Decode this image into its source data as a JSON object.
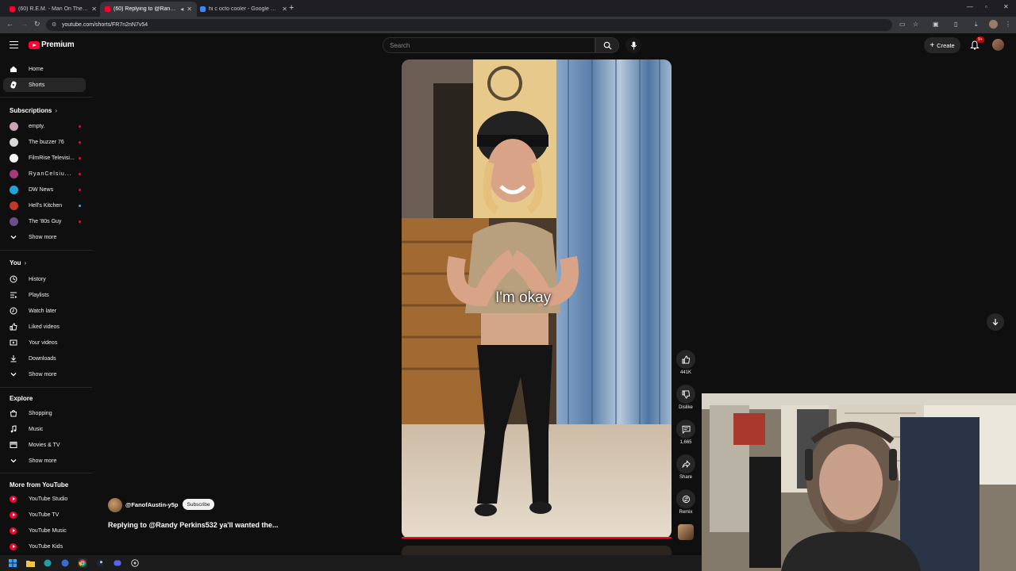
{
  "browser": {
    "tabs": [
      {
        "title": "(60) R.E.M. - Man On The Moo",
        "active": false
      },
      {
        "title": "(60) Replying to @Randy P",
        "active": true
      },
      {
        "title": "hi c octo cooler - Google Shopp",
        "active": false
      }
    ],
    "url": "youtube.com/shorts/FR7n2nN7v54"
  },
  "header": {
    "brand": "Premium",
    "search_placeholder": "Search",
    "create_label": "Create",
    "notification_count": "9+"
  },
  "sidebar": {
    "main": [
      {
        "label": "Home",
        "icon": "home-icon"
      },
      {
        "label": "Shorts",
        "icon": "shorts-icon",
        "selected": true
      }
    ],
    "subscriptions_title": "Subscriptions",
    "subscriptions": [
      {
        "label": "empty.",
        "color": "#c9a3b6"
      },
      {
        "label": "The buzzer 76",
        "color": "#d8d8d8"
      },
      {
        "label": "FilmRise Televisi...",
        "color": "#f5f5f5"
      },
      {
        "label": "RyanCelsiu...",
        "color": "#a43b7a"
      },
      {
        "label": "DW News",
        "color": "#1fa3d9"
      },
      {
        "label": "Hell's Kitchen",
        "color": "#c0392b"
      },
      {
        "label": "The '80s Guy",
        "color": "#6a4f8a"
      }
    ],
    "subs_show_more": "Show more",
    "you_title": "You",
    "you_items": [
      {
        "label": "History",
        "icon": "history-icon"
      },
      {
        "label": "Playlists",
        "icon": "playlists-icon"
      },
      {
        "label": "Watch later",
        "icon": "watch-later-icon"
      },
      {
        "label": "Liked videos",
        "icon": "liked-icon"
      },
      {
        "label": "Your videos",
        "icon": "your-videos-icon"
      },
      {
        "label": "Downloads",
        "icon": "downloads-icon"
      }
    ],
    "you_show_more": "Show more",
    "explore_title": "Explore",
    "explore_items": [
      {
        "label": "Shopping",
        "icon": "shopping-icon"
      },
      {
        "label": "Music",
        "icon": "music-icon"
      },
      {
        "label": "Movies & TV",
        "icon": "movies-icon"
      }
    ],
    "explore_show_more": "Show more",
    "more_title": "More from YouTube",
    "more_items": [
      {
        "label": "YouTube Studio"
      },
      {
        "label": "YouTube TV"
      },
      {
        "label": "YouTube Music"
      },
      {
        "label": "YouTube Kids"
      }
    ]
  },
  "video": {
    "caption": "I'm okay",
    "channel": "@FanofAustin-y5p",
    "subscribe_label": "Subscribe",
    "title": "Replying to @Randy Perkins532 ya'll wanted the..."
  },
  "actions": {
    "likes": "441K",
    "dislike_label": "Dislike",
    "comments": "1,665",
    "share_label": "Share",
    "remix_label": "Remix"
  },
  "colors": {
    "accent": "#ff0033",
    "bg": "#0f0f0f",
    "chip": "#272727"
  }
}
